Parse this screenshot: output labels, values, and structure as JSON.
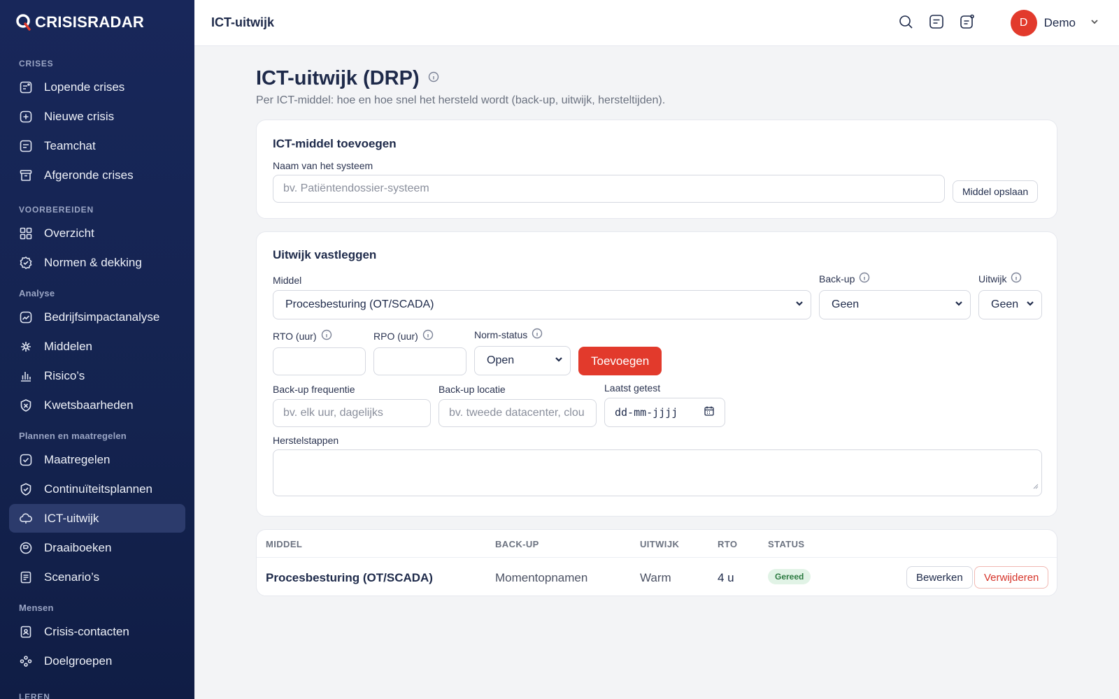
{
  "brand": {
    "name": "CRISISRADAR"
  },
  "sidebar": {
    "sections": [
      {
        "label": "CRISES",
        "items": [
          {
            "label": "Lopende crises",
            "icon": "message-clock-icon"
          },
          {
            "label": "Nieuwe crisis",
            "icon": "plus-square-icon"
          },
          {
            "label": "Teamchat",
            "icon": "chat-icon"
          },
          {
            "label": "Afgeronde crises",
            "icon": "archive-icon"
          }
        ]
      },
      {
        "label": "VOORBEREIDEN",
        "items": [
          {
            "label": "Overzicht",
            "icon": "grid-icon"
          },
          {
            "label": "Normen & dekking",
            "icon": "badge-check-icon"
          }
        ]
      },
      {
        "label": "Analyse",
        "items": [
          {
            "label": "Bedrijfsimpactanalyse",
            "icon": "chart-line-icon"
          },
          {
            "label": "Middelen",
            "icon": "network-icon"
          },
          {
            "label": "Risico’s",
            "icon": "bar-chart-icon"
          },
          {
            "label": "Kwetsbaarheden",
            "icon": "shield-alert-icon"
          }
        ]
      },
      {
        "label": "Plannen en maatregelen",
        "items": [
          {
            "label": "Maatregelen",
            "icon": "check-square-icon"
          },
          {
            "label": "Continuïteitsplannen",
            "icon": "shield-check-icon"
          },
          {
            "label": "ICT-uitwijk",
            "icon": "cloud-icon",
            "active": true
          },
          {
            "label": "Draaiboeken",
            "icon": "book-icon"
          },
          {
            "label": "Scenario’s",
            "icon": "document-icon"
          }
        ]
      },
      {
        "label": "Mensen",
        "items": [
          {
            "label": "Crisis-contacten",
            "icon": "contact-card-icon"
          },
          {
            "label": "Doelgroepen",
            "icon": "group-icon"
          }
        ]
      },
      {
        "label": "LEREN",
        "items": []
      }
    ]
  },
  "topbar": {
    "title": "ICT-uitwijk",
    "user": {
      "initial": "D",
      "name": "Demo"
    }
  },
  "page": {
    "title": "ICT-uitwijk (DRP)",
    "subtitle": "Per ICT-middel: hoe en hoe snel het hersteld wordt (back-up, uitwijk, hersteltijden)."
  },
  "add_card": {
    "title": "ICT-middel toevoegen",
    "name_label": "Naam van het systeem",
    "name_placeholder": "bv. Patiëntendossier-systeem",
    "save_label": "Middel opslaan"
  },
  "fallback_card": {
    "title": "Uitwijk vastleggen",
    "middel_label": "Middel",
    "middel_value": "Procesbesturing (OT/SCADA)",
    "backup_label": "Back-up",
    "backup_value": "Geen",
    "uitwijk_label": "Uitwijk",
    "uitwijk_value": "Geen",
    "rto_label": "RTO (uur)",
    "rpo_label": "RPO (uur)",
    "norm_label": "Norm-status",
    "norm_value": "Open",
    "add_label": "Toevoegen",
    "freq_label": "Back-up frequentie",
    "freq_placeholder": "bv. elk uur, dagelijks",
    "loc_label": "Back-up locatie",
    "loc_placeholder": "bv. tweede datacenter, clou",
    "tested_label": "Laatst getest",
    "tested_placeholder": "dd-mm-jjjj",
    "steps_label": "Herstelstappen"
  },
  "table": {
    "headers": [
      "MIDDEL",
      "BACK-UP",
      "UITWIJK",
      "RTO",
      "STATUS"
    ],
    "rows": [
      {
        "middel": "Procesbesturing (OT/SCADA)",
        "backup": "Momentopnamen",
        "uitwijk": "Warm",
        "rto": "4 u",
        "status": "Gereed",
        "edit": "Bewerken",
        "delete": "Verwijderen"
      }
    ]
  }
}
